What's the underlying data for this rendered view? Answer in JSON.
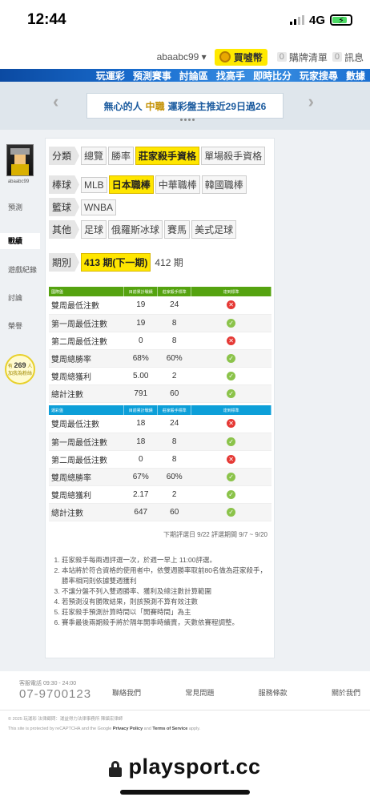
{
  "status": {
    "time": "12:44",
    "network": "4G"
  },
  "topbar": {
    "username": "abaabc99 ▾",
    "coins_label": "買噓幣",
    "cart_count": "0",
    "cart_label": "購牌清單",
    "msg_count": "0",
    "msg_label": "訊息"
  },
  "nav": {
    "items": [
      "玩運彩",
      "預測賽事",
      "討論區",
      "找高手",
      "即時比分",
      "玩家搜尋",
      "數據"
    ]
  },
  "banner": {
    "prefix": "無心的人",
    "league": "中職",
    "text": "運彩盤主推近29日過26"
  },
  "sidebar": {
    "username": "abaabc99",
    "items": [
      "預測",
      "戰績",
      "遊戲紀錄",
      "討論",
      "榮譽"
    ],
    "active": "戰績",
    "online_prefix": "有",
    "online_count": "269",
    "online_suffix": "人",
    "online_line2": "加我為粉絲"
  },
  "categories": {
    "row1": {
      "label": "分類",
      "tabs": [
        "總覽",
        "勝率",
        "莊家殺手資格",
        "單場殺手資格"
      ],
      "selected": "莊家殺手資格"
    },
    "row2": {
      "label": "棒球",
      "tabs": [
        "MLB",
        "日本職棒",
        "中華職棒",
        "韓國職棒"
      ],
      "selected": "日本職棒"
    },
    "row3": {
      "label": "籃球",
      "tabs": [
        "WNBA"
      ]
    },
    "row4": {
      "label": "其他",
      "tabs": [
        "足球",
        "俄羅斯冰球",
        "賽馬",
        "美式足球"
      ]
    },
    "period": {
      "label": "期別",
      "current": "413 期(下一期)",
      "other": "412 期"
    }
  },
  "table_headers": {
    "col2": "目前累計戰績",
    "col3": "莊家殺手標準",
    "col4": "達到標準"
  },
  "table_international": {
    "title": "國際盤",
    "rows": [
      {
        "name": "雙周最低注數",
        "current": "19",
        "standard": "24",
        "met": false
      },
      {
        "name": "第一周最低注數",
        "current": "19",
        "standard": "8",
        "met": true
      },
      {
        "name": "第二周最低注數",
        "current": "0",
        "standard": "8",
        "met": false
      },
      {
        "name": "雙周總勝率",
        "current": "68%",
        "standard": "60%",
        "met": true
      },
      {
        "name": "雙周總獲利",
        "current": "5.00",
        "standard": "2",
        "met": true
      },
      {
        "name": "總計注數",
        "current": "791",
        "standard": "60",
        "met": true
      }
    ]
  },
  "table_lottery": {
    "title": "運彩盤",
    "rows": [
      {
        "name": "雙周最低注數",
        "current": "18",
        "standard": "24",
        "met": false
      },
      {
        "name": "第一周最低注數",
        "current": "18",
        "standard": "8",
        "met": true
      },
      {
        "name": "第二周最低注數",
        "current": "0",
        "standard": "8",
        "met": false
      },
      {
        "name": "雙周總勝率",
        "current": "67%",
        "standard": "60%",
        "met": true
      },
      {
        "name": "雙周總獲利",
        "current": "2.17",
        "standard": "2",
        "met": true
      },
      {
        "name": "總計注數",
        "current": "647",
        "standard": "60",
        "met": true
      }
    ]
  },
  "period_info": "下期評選日 9/22   評選期間 9/7 ~ 9/20",
  "notes": [
    "莊家殺手每兩週評選一次，於週一早上 11:00評選。",
    "本站將於符合資格的使用者中，依雙週勝率取前80名做為莊家殺手，勝率相同則依據雙週獲利",
    "不讓分盤不列入雙週勝率、獲利及總注數計算範圍",
    "若預測沒有勝敗結果，則該預測不算有效注數",
    "莊家殺手預測計算時間以「開賽時間」為主",
    "賽季最後兩期殺手將於隔年開季時續賣，天數依賽程調整。"
  ],
  "footer": {
    "service_hours": "客服電話 09:30 - 24:00",
    "phone": "07-9700123",
    "links": [
      "聯絡我們",
      "常見問題",
      "服務條款",
      "關於我們"
    ],
    "copyright": "© 2025 玩運彩 法律顧問：運益得力法律事務所 陳鎮宏律師",
    "recaptcha_pre": "This site is protected by reCAPTCHA and the Google ",
    "privacy": "Privacy Policy",
    "and": " and ",
    "terms": "Terms of Service",
    "apply": " apply."
  },
  "address": {
    "url": "playsport.cc"
  },
  "icons": [
    "signal-icon",
    "battery-icon",
    "coin-icon",
    "chevron-left-icon",
    "chevron-right-icon",
    "lock-icon",
    "cross-icon",
    "check-icon",
    "bulb-icon"
  ],
  "colors": {
    "selected": "#ffe600",
    "green_header": "#55a310",
    "blue_header": "#0d9fd8",
    "fail": "#e53935",
    "pass": "#8bc34a",
    "nav": "#1a6fd1"
  }
}
